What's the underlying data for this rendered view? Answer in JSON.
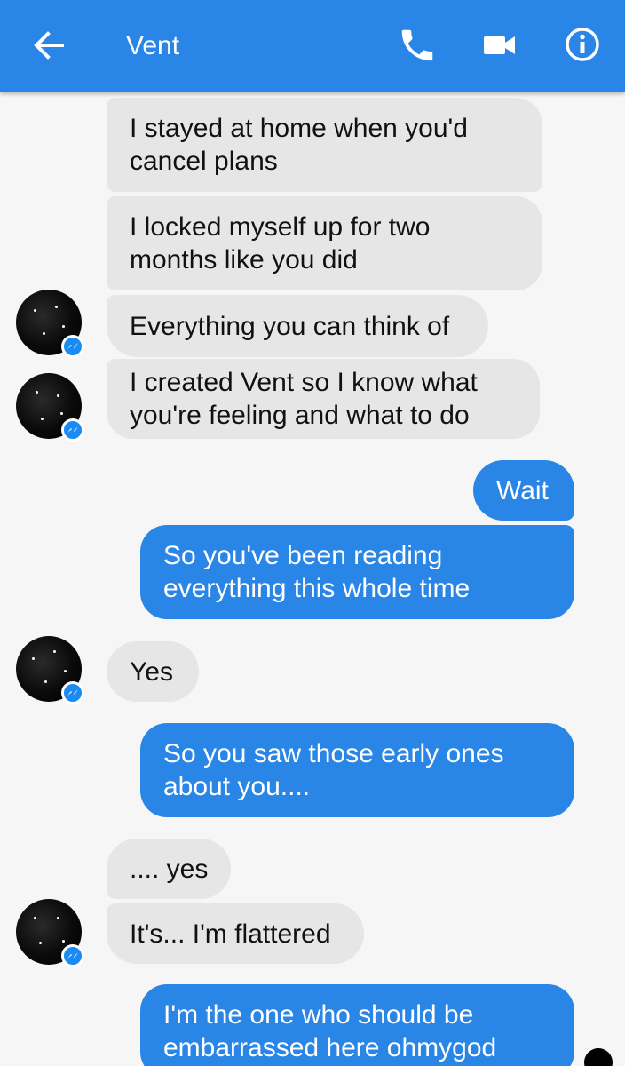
{
  "header": {
    "title": "Vent",
    "icons": [
      "back-arrow-icon",
      "phone-icon",
      "video-camera-icon",
      "info-icon"
    ]
  },
  "colors": {
    "accent": "#2a86e6",
    "incoming_bubble": "#e6e6e6",
    "background": "#f6f6f6"
  },
  "messages": [
    {
      "from": "them",
      "lines": [
        "I stayed at home when you'd",
        "cancel plans"
      ]
    },
    {
      "from": "them",
      "lines": [
        "I locked myself up for two",
        "months like you did"
      ]
    },
    {
      "from": "them",
      "lines": [
        "Everything you can think of"
      ]
    },
    {
      "from": "them",
      "lines": [
        "I created Vent so I know what",
        "you're feeling and what to do"
      ]
    },
    {
      "from": "me",
      "lines": [
        "Wait"
      ]
    },
    {
      "from": "me",
      "lines": [
        "So you've been reading",
        "everything this whole time"
      ]
    },
    {
      "from": "them",
      "lines": [
        "Yes"
      ]
    },
    {
      "from": "me",
      "lines": [
        "So you saw those early ones",
        "about you...."
      ]
    },
    {
      "from": "them",
      "lines": [
        ".... yes"
      ]
    },
    {
      "from": "them",
      "lines": [
        "It's... I'm flattered"
      ]
    },
    {
      "from": "me",
      "lines": [
        "I'm the one who should be",
        "embarrassed here ohmygod"
      ]
    }
  ]
}
